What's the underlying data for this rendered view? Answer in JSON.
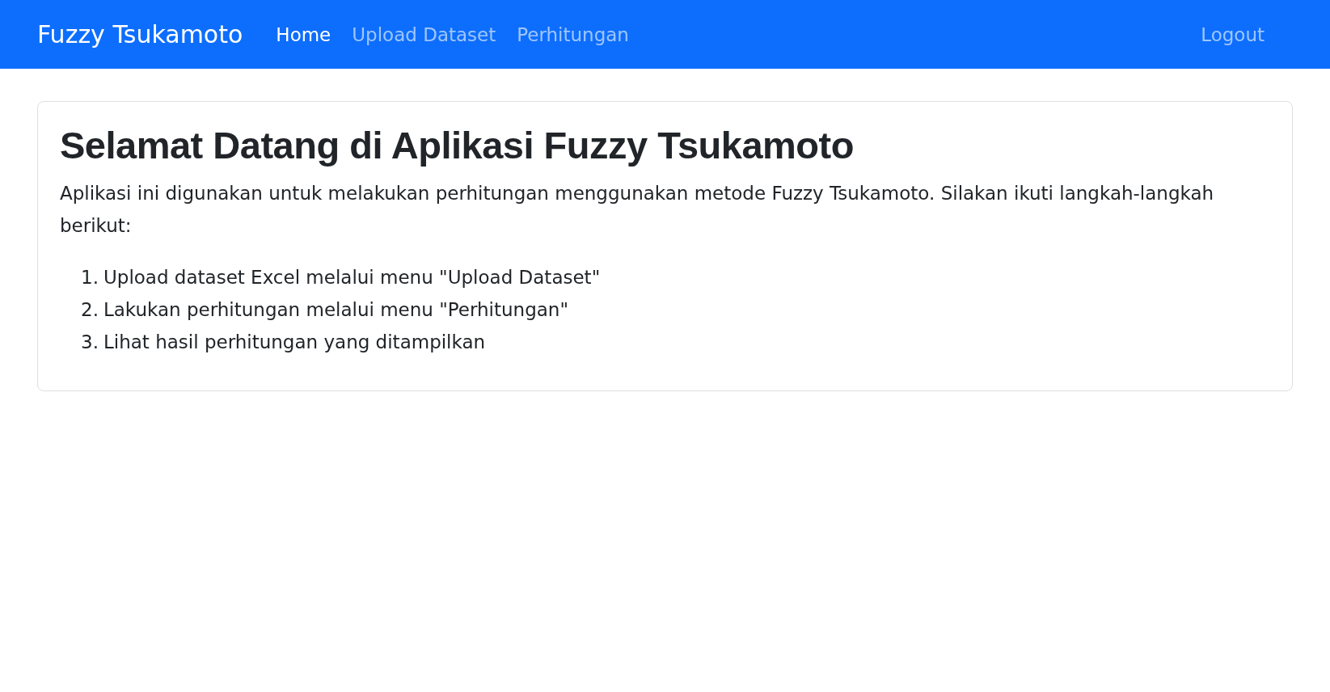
{
  "navbar": {
    "brand": "Fuzzy Tsukamoto",
    "links": [
      {
        "label": "Home",
        "selected": true
      },
      {
        "label": "Upload Dataset",
        "selected": false
      },
      {
        "label": "Perhitungan",
        "selected": false
      }
    ],
    "logout": "Logout"
  },
  "card": {
    "title": "Selamat Datang di Aplikasi Fuzzy Tsukamoto",
    "intro": "Aplikasi ini digunakan untuk melakukan perhitungan menggunakan metode Fuzzy Tsukamoto. Silakan ikuti langkah-langkah berikut:",
    "steps": [
      {
        "number": "1.",
        "text": "Upload dataset Excel melalui menu \"Upload Dataset\""
      },
      {
        "number": "2.",
        "text": "Lakukan perhitungan melalui menu \"Perhitungan\""
      },
      {
        "number": "3.",
        "text": "Lihat hasil perhitungan yang ditampilkan"
      }
    ]
  }
}
